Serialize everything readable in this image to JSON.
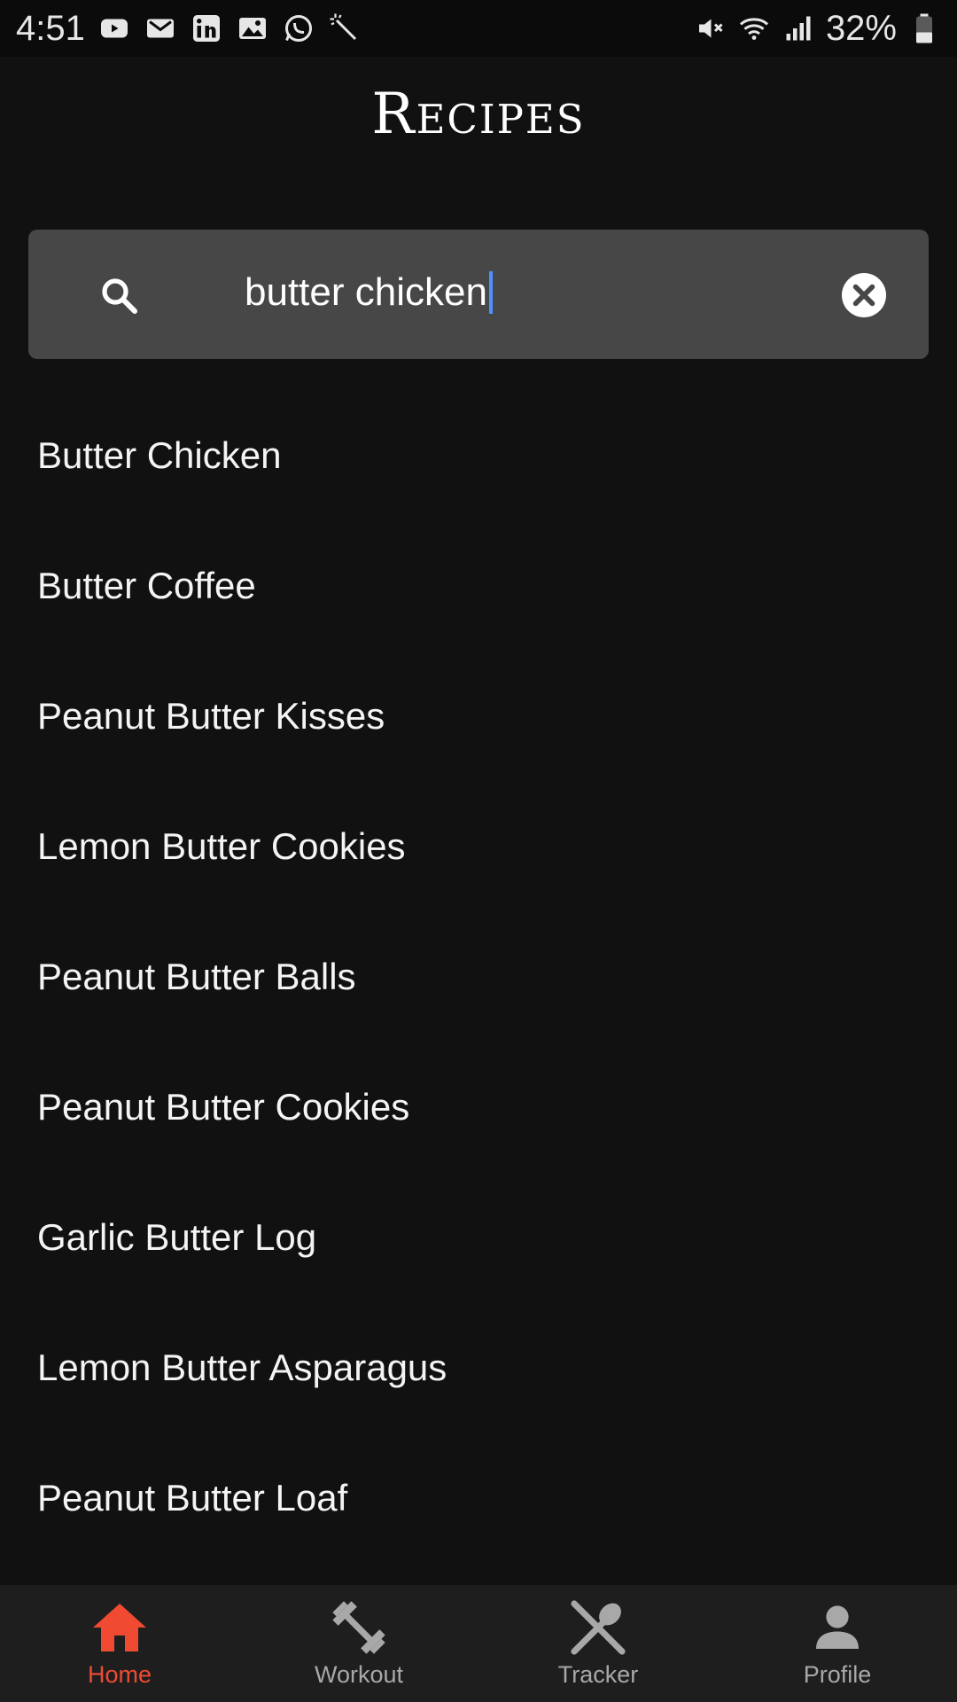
{
  "status_bar": {
    "time": "4:51",
    "battery": "32%",
    "icons_left": [
      "youtube-icon",
      "gmail-icon",
      "linkedin-icon",
      "gallery-icon",
      "whatsapp-icon",
      "magic-wand-icon"
    ],
    "icons_right": [
      "mute-icon",
      "wifi-icon",
      "signal-icon",
      "battery-icon"
    ]
  },
  "page": {
    "title": "Recipes"
  },
  "search": {
    "value": "butter chicken"
  },
  "results": [
    "Butter Chicken",
    "Butter Coffee",
    "Peanut Butter Kisses",
    "Lemon Butter Cookies",
    "Peanut Butter Balls",
    "Peanut Butter Cookies",
    "Garlic Butter Log",
    "Lemon Butter Asparagus",
    "Peanut Butter Loaf"
  ],
  "nav": {
    "items": [
      {
        "label": "Home",
        "icon": "home-icon",
        "active": true
      },
      {
        "label": "Workout",
        "icon": "dumbbell-icon",
        "active": false
      },
      {
        "label": "Tracker",
        "icon": "utensils-icon",
        "active": false
      },
      {
        "label": "Profile",
        "icon": "person-icon",
        "active": false
      }
    ]
  },
  "colors": {
    "accent": "#f04a32",
    "background": "#111112",
    "search_bg": "#474747",
    "nav_bg": "#1e1e1f",
    "caret": "#4f8fff"
  }
}
